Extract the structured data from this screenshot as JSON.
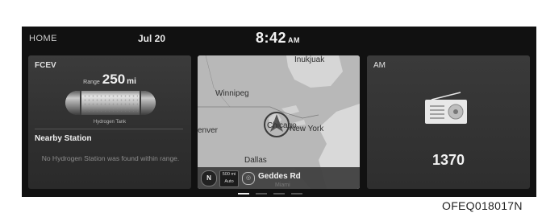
{
  "status_bar": {
    "home": "HOME",
    "date": "Jul 20",
    "time": "8:42",
    "ampm": "AM"
  },
  "fcev": {
    "title": "FCEV",
    "range_label": "Range",
    "range_value": "250",
    "range_unit": "mi",
    "tank_label": "Hydrogen Tank",
    "nearby_title": "Nearby Station",
    "nearby_message": "No Hydrogen Station was found within range."
  },
  "map": {
    "cities": [
      "Inukjuak",
      "Winnipeg",
      "Chicago",
      "New York",
      "enver",
      "Dallas"
    ],
    "faint_city": "Miami",
    "compass": "N",
    "scale_top": "500 mi",
    "scale_bottom": "Auto",
    "road": "Geddes Rd"
  },
  "am": {
    "title": "AM",
    "frequency": "1370"
  },
  "pager": {
    "pages": 4,
    "active": 1
  },
  "figure_code": "OFEQ018017N"
}
